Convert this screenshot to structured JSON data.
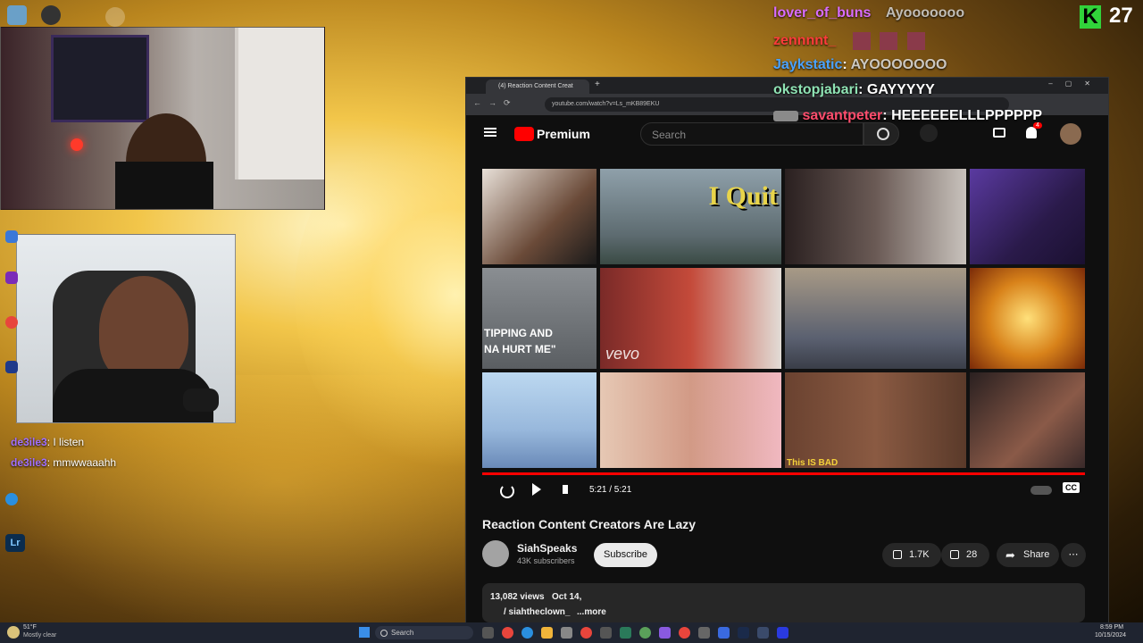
{
  "stream": {
    "kick_viewer_count": "27",
    "chat": [
      {
        "user": "lover_of_buns",
        "msg": "Ayooooooo",
        "color": "#d86cff"
      },
      {
        "user": "zennnnt_",
        "msg": "",
        "color": "#ff3b3b"
      },
      {
        "user": "Jaykstatic",
        "msg": "AYOOOOOOO",
        "color": "#4aa3ff"
      },
      {
        "user": "okstopjabari",
        "msg": "GAYYYYY",
        "color": "#8fe3b4"
      },
      {
        "user": "savantpeter",
        "msg": "HEEEEEELLLPPPPPP",
        "color": "#ff4d6d"
      }
    ],
    "side_chat": [
      {
        "user": "de3ile3",
        "msg": ": I listen"
      },
      {
        "user": "de3ile3",
        "msg": ": mmwwaaahh"
      }
    ]
  },
  "browser": {
    "tab_title": "(4) Reaction Content Creat",
    "url": "youtube.com/watch?v=Ls_mKB89EKU"
  },
  "youtube": {
    "logo_text": "Premium",
    "search_placeholder": "Search",
    "notification_count": "4",
    "player_time": "5:21 / 5:21",
    "cc_label": "CC",
    "video_title": "Reaction Content Creators Are Lazy",
    "channel_name": "SiahSpeaks",
    "subscribers": "43K subscribers",
    "subscribe_label": "Subscribe",
    "likes": "1.7K",
    "dislikes": "28",
    "share_label": "Share",
    "views": "13,082 views",
    "date": "Oct 14,",
    "desc_link": "/ siahtheclown_",
    "more_label": "...more",
    "thumb_text_1": "I Quit",
    "thumb_text_2": "TIPPING AND",
    "thumb_text_3": "NA HURT ME\"",
    "thumb_text_4": "vevo",
    "thumb_text_5": "This IS BAD"
  },
  "taskbar": {
    "weather_temp": "51°F",
    "weather_desc": "Mostly clear",
    "search_label": "Search",
    "time": "8:59 PM",
    "date": "10/15/2024"
  },
  "colors": {
    "youtube_red": "#ff0000",
    "kick_green": "#31d33a"
  }
}
